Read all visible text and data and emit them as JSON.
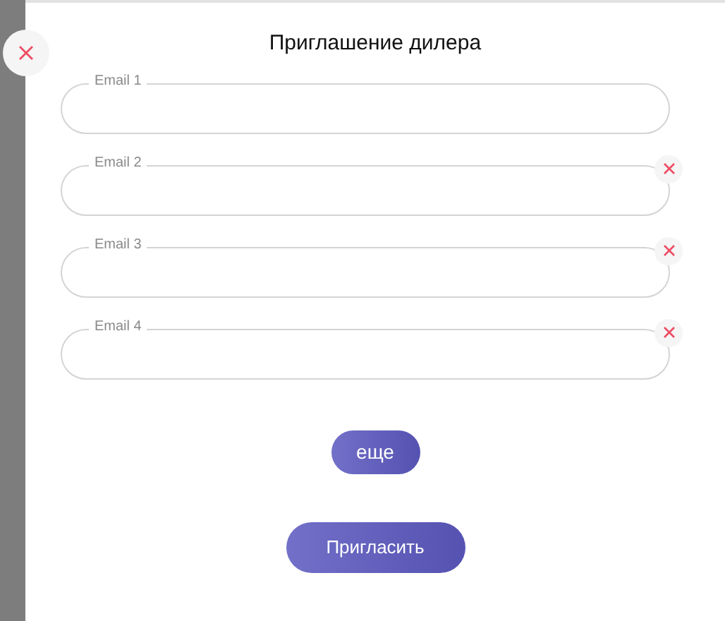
{
  "dialog": {
    "title": "Приглашение дилера",
    "fields": [
      {
        "label": "Email 1",
        "removable": false
      },
      {
        "label": "Email 2",
        "removable": true
      },
      {
        "label": "Email 3",
        "removable": true
      },
      {
        "label": "Email 4",
        "removable": true
      }
    ],
    "more_button": "еще",
    "submit_button": "Пригласить"
  }
}
